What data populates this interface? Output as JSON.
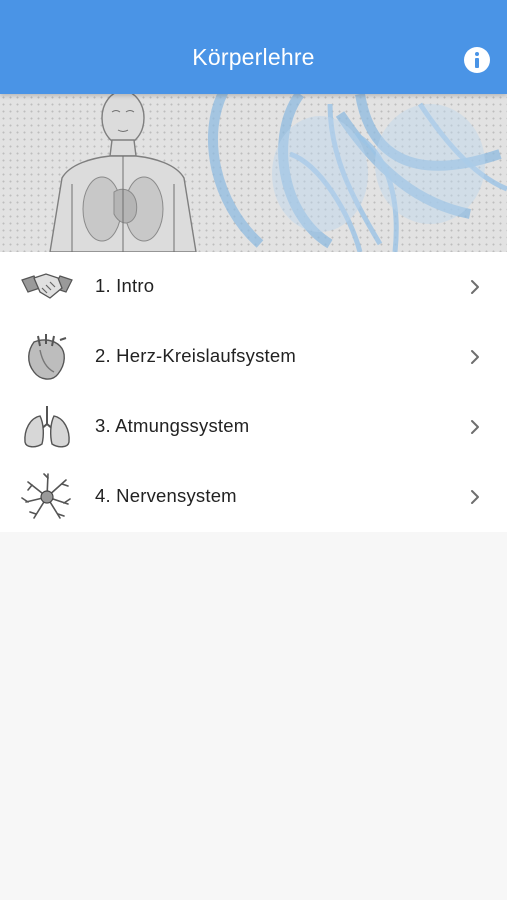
{
  "header": {
    "title": "Körperlehre",
    "info_icon": "info-icon"
  },
  "banner": {
    "image": "anatomy-illustration"
  },
  "menu": {
    "items": [
      {
        "label": "1. Intro",
        "icon": "handshake-icon"
      },
      {
        "label": "2. Herz-Kreislaufsystem",
        "icon": "heart-icon"
      },
      {
        "label": "3. Atmungssystem",
        "icon": "lungs-icon"
      },
      {
        "label": "4. Nervensystem",
        "icon": "neuron-icon"
      }
    ]
  },
  "colors": {
    "header": "#4a94e6",
    "background": "#f7f7f7",
    "text": "#222222"
  }
}
